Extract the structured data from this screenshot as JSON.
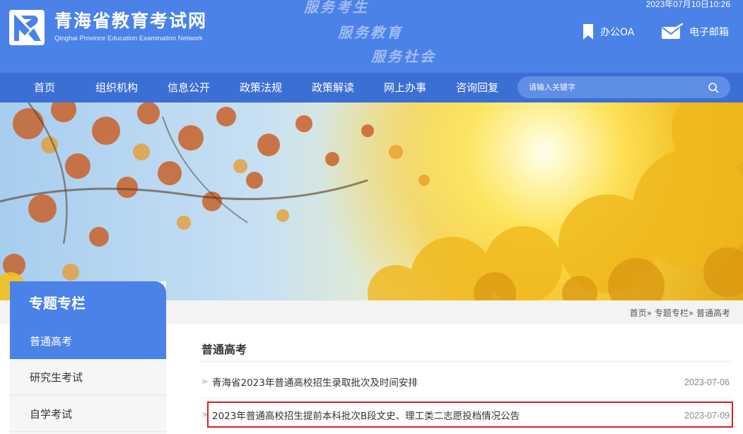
{
  "header": {
    "site_title": "青海省教育考试网",
    "site_subtitle": "Qinghai Province Education Examination Network",
    "slogans": [
      "服务考生",
      "服务教育",
      "服务社会"
    ],
    "datetime": "2023年07月10日10:26",
    "links": {
      "oa": "办公OA",
      "mail": "电子邮箱"
    }
  },
  "nav": {
    "items": [
      "首页",
      "组织机构",
      "信息公开",
      "政策法规",
      "政策解读",
      "网上办事",
      "咨询回复"
    ],
    "search_placeholder": "请输入关键字"
  },
  "breadcrumb": {
    "home": "首页»",
    "section": "专题专栏»",
    "current": "普通高考"
  },
  "sidebar": {
    "title": "专题专栏",
    "items": [
      "普通高考",
      "研究生考试",
      "自学考试"
    ]
  },
  "main": {
    "title": "普通高考",
    "news": [
      {
        "title": "青海省2023年普通高校招生录取批次及时间安排",
        "date": "2023-07-06"
      },
      {
        "title": "2023年普通高校招生提前本科批次B段文史、理工类二志愿投档情况公告",
        "date": "2023-07-09"
      }
    ]
  },
  "colors": {
    "brand": "#4b82e8",
    "nav": "#3c6fd4",
    "highlight": "#d51f28"
  },
  "icons": {
    "logo": "logo-mark-icon",
    "oa": "bookmark-icon",
    "mail": "mail-icon",
    "search": "search-icon"
  }
}
